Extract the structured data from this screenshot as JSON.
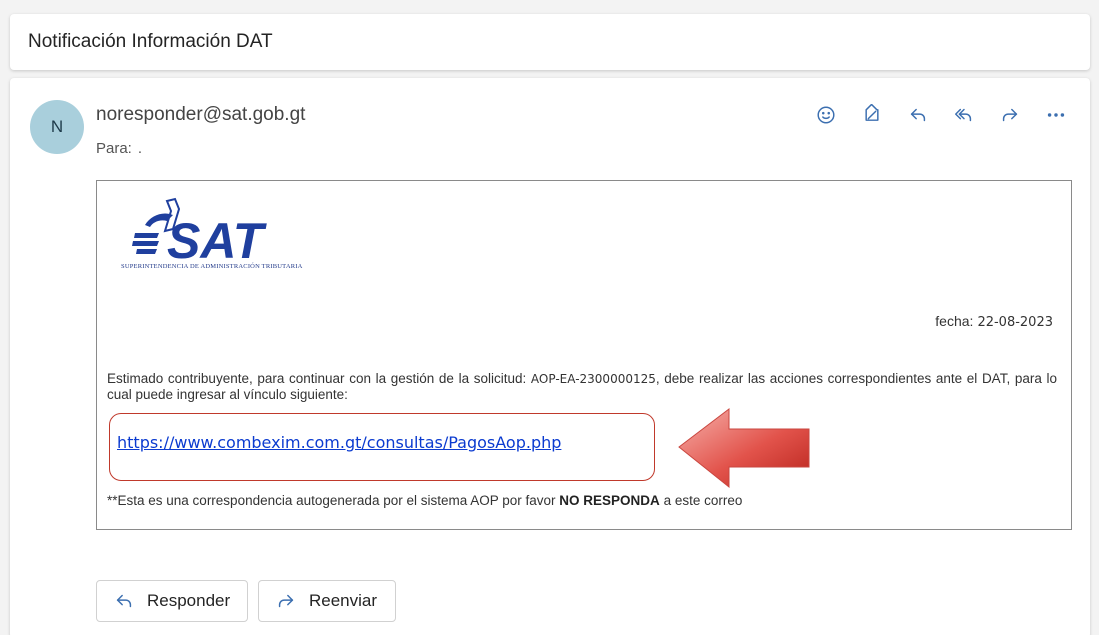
{
  "subject": "Notificación Información DAT",
  "sender": {
    "initial": "N",
    "email": "noresponder@sat.gob.gt",
    "to_label": "Para:",
    "to_value": "."
  },
  "actions": [
    {
      "name": "emoji-icon"
    },
    {
      "name": "tag-icon"
    },
    {
      "name": "reply-icon"
    },
    {
      "name": "reply-all-icon"
    },
    {
      "name": "forward-icon"
    },
    {
      "name": "more-icon"
    }
  ],
  "email": {
    "logo_text": "SAT",
    "logo_subtitle": "Superintendencia de Administración Tributaria",
    "date_label": "fecha:",
    "date_value": "22-08-2023",
    "body_prefix": "Estimado contribuyente, para continuar con la gestión de la solicitud:",
    "request_id": "AOP-EA-2300000125",
    "body_suffix": ", debe realizar las acciones correspondientes ante el DAT, para lo cual puede ingresar al vínculo siguiente:",
    "link": "https://www.combexim.com.gt/consultas/PagosAop.php",
    "footer_prefix": "**Esta es una correspondencia autogenerada por el sistema AOP por favor",
    "footer_bold": "NO RESPONDA",
    "footer_suffix": "a este correo"
  },
  "buttons": {
    "reply": "Responder",
    "forward": "Reenviar"
  },
  "colors": {
    "accent": "#3c6fb0",
    "link": "#0b3bd0",
    "highlight_border": "#c0392b",
    "arrow": "#e2534b",
    "avatar_bg": "#a9cfdc",
    "logo_blue": "#1f3f9e"
  }
}
